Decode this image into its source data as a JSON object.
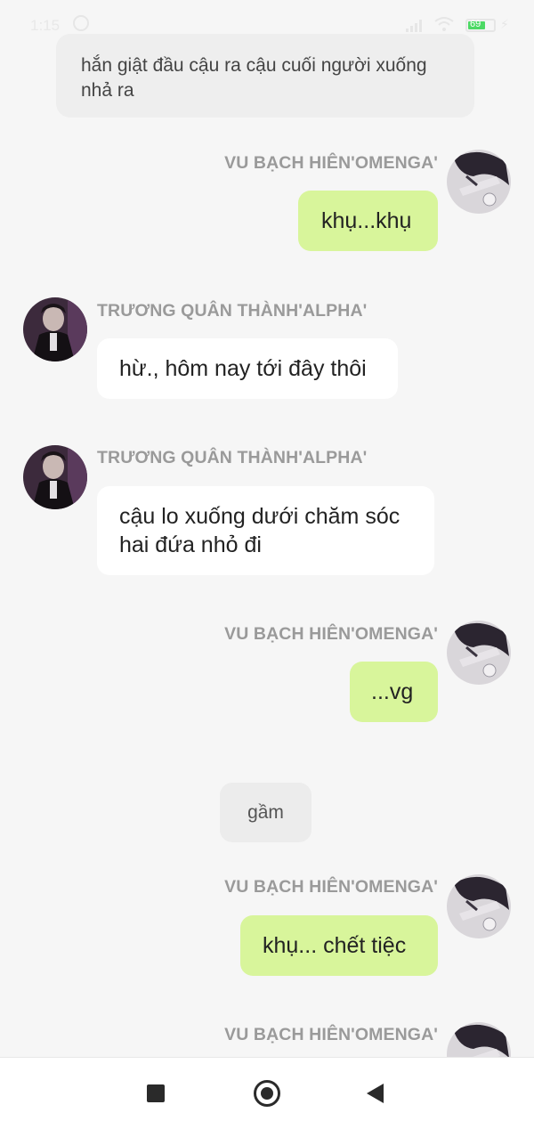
{
  "status_bar": {
    "time": "1:15",
    "battery": "69"
  },
  "messages": {
    "narration_1": "hắn giật đầu cậu ra cậu cuối người xuống nhả ra",
    "m1": {
      "sender": "VU BẠCH HIÊN'OMENGA'",
      "text": "khụ...khụ"
    },
    "m2": {
      "sender": "TRƯƠNG QUÂN THÀNH'ALPHA'",
      "text": "hừ., hôm nay tới đây thôi"
    },
    "m3": {
      "sender": "TRƯƠNG QUÂN THÀNH'ALPHA'",
      "text": "cậu lo xuống dưới chăm sóc hai đứa nhỏ đi"
    },
    "m4": {
      "sender": "VU BẠCH HIÊN'OMENGA'",
      "text": "...vg"
    },
    "narration_2": "gầm",
    "m5": {
      "sender": "VU BẠCH HIÊN'OMENGA'",
      "text": "khụ... chết tiệc"
    },
    "m6": {
      "sender": "VU BẠCH HIÊN'OMENGA'"
    }
  },
  "colors": {
    "background": "#f6f6f6",
    "my_bubble": "#d8f59b",
    "their_bubble": "#ffffff",
    "narration_bubble": "#eeeeee",
    "name_text": "#9a9a9a"
  }
}
